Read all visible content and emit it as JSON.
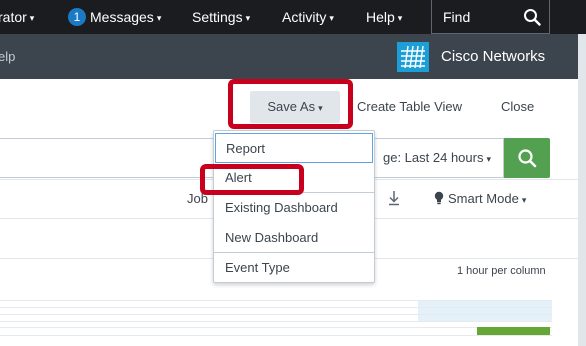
{
  "topbar": {
    "user_menu_label": "rator",
    "messages_count": "1",
    "messages_label": "Messages",
    "settings_label": "Settings",
    "activity_label": "Activity",
    "help_label": "Help",
    "find_label": "Find",
    "caret": "▾"
  },
  "appbar": {
    "help_link": "elp",
    "app_name": "Cisco Networks"
  },
  "toolbar": {
    "save_as_label": "Save As",
    "create_table_view_label": "Create Table View",
    "close_label": "Close"
  },
  "search": {
    "time_range_label": "ge: Last 24 hours"
  },
  "jobbar": {
    "job_label": "Job",
    "smart_mode_label": "Smart Mode"
  },
  "timeline": {
    "per_column_label": "1 hour per column"
  },
  "save_as_menu": {
    "items": [
      {
        "label": "Report"
      },
      {
        "label": "Alert"
      },
      {
        "label": "Existing Dashboard"
      },
      {
        "label": "New Dashboard"
      },
      {
        "label": "Event Type"
      }
    ]
  },
  "colors": {
    "topbar_bg": "#1a1c20",
    "appbar_bg": "#3c444d",
    "search_button": "#53a051",
    "highlight": "#c8001e",
    "app_logo": "#1c9fd6"
  }
}
